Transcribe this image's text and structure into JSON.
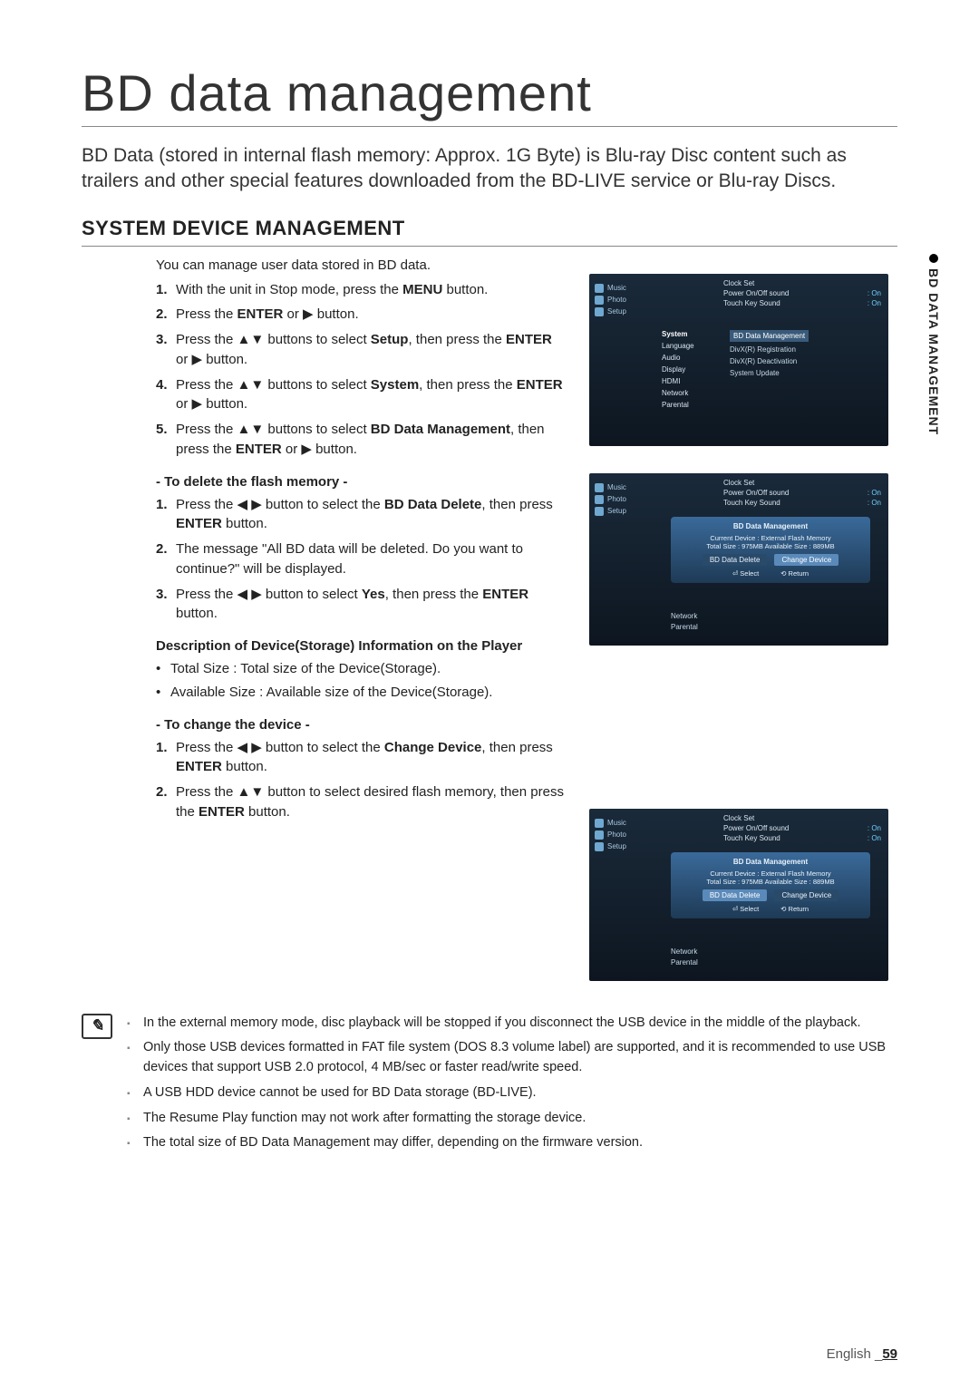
{
  "title": "BD data management",
  "intro": "BD Data (stored in internal flash memory: Approx. 1G Byte) is Blu-ray Disc content such as trailers and other special features downloaded from the BD-LIVE service or Blu-ray Discs.",
  "section_heading": "SYSTEM DEVICE MANAGEMENT",
  "lead": "You can manage user data stored in BD data.",
  "steps": [
    {
      "n": "1.",
      "pre": "With the unit in Stop mode, press the ",
      "bold": "MENU",
      "post": " button."
    },
    {
      "n": "2.",
      "pre": "Press the ",
      "bold": "ENTER",
      "post": " or ▶ button."
    },
    {
      "n": "3.",
      "pre": "Press the ▲▼ buttons to select ",
      "bold": "Setup",
      "post": ", then press the ENTER or ▶ button.",
      "boldPost": "ENTER"
    },
    {
      "n": "4.",
      "pre": "Press the ▲▼ buttons to select ",
      "bold": "System",
      "post": ", then press the ENTER or ▶ button.",
      "boldPost": "ENTER"
    },
    {
      "n": "5.",
      "pre": "Press the ▲▼ buttons to select ",
      "bold": "BD Data Management",
      "post": ", then press the  ENTER or ▶ button.",
      "boldPost": "ENTER"
    }
  ],
  "sub1": "- To delete the flash memory -",
  "sub1_steps": [
    {
      "n": "1.",
      "pre": "Press the ◀ ▶ button to select the ",
      "bold": "BD Data Delete",
      "post": ", then press ENTER button.",
      "boldPost": "ENTER"
    },
    {
      "n": "2.",
      "text": "The message \"All BD data will be deleted. Do you want to continue?\" will be displayed."
    },
    {
      "n": "3.",
      "pre": "Press the ◀ ▶ button to select ",
      "bold": "Yes",
      "post": ", then press the ENTER button.",
      "boldPost": "ENTER"
    }
  ],
  "desc_head": "Description of Device(Storage) Information on the Player",
  "desc_items": [
    "Total Size : Total size of the Device(Storage).",
    "Available Size : Available size of the Device(Storage)."
  ],
  "sub2": "- To change the device -",
  "sub2_steps": [
    {
      "n": "1.",
      "pre": "Press the ◀ ▶ button to select the ",
      "bold": "Change Device",
      "post": ", then press ENTER button.",
      "boldPost": "ENTER"
    },
    {
      "n": "2.",
      "pre": "Press the ▲▼ button to select desired flash memory, then press the ",
      "bold": "ENTER",
      "post": " button."
    }
  ],
  "notes": [
    "In the external memory mode, disc playback will be stopped if you disconnect the USB device in the middle of the playback.",
    "Only those USB devices formatted in FAT file system (DOS 8.3 volume label) are supported, and it is recommended to use USB devices that support USB 2.0 protocol, 4 MB/sec or faster read/write speed.",
    "A USB HDD device cannot be used for BD Data storage (BD-LIVE).",
    "The Resume Play function may not work after formatting the storage device.",
    "The total size of BD Data Management may differ, depending on the firmware version."
  ],
  "sidetab": "BD DATA MANAGEMENT",
  "footer_lang": "English",
  "footer_page": "59",
  "shot_common": {
    "side_items": [
      "Music",
      "Photo",
      "Setup"
    ],
    "top_rows": [
      {
        "l": "Clock Set",
        "r": ""
      },
      {
        "l": "Power On/Off sound",
        "r": ": On"
      },
      {
        "l": "Touch Key Sound",
        "r": ": On"
      }
    ],
    "mid_items": [
      "System",
      "Language",
      "Audio",
      "Display",
      "HDMI",
      "Network",
      "Parental"
    ]
  },
  "shot1_right": [
    "BD Data Management",
    "DivX(R) Registration",
    "DivX(R) Deactivation",
    "System Update"
  ],
  "shot_panel": {
    "title": "BD Data Management",
    "line": "Current Device : External Flash Memory\nTotal Size : 975MB    Available Size : 889MB",
    "btn1": "BD Data Delete",
    "btn2": "Change Device",
    "foot1": "Select",
    "foot2": "Return",
    "below": [
      "Network",
      "Parental"
    ]
  }
}
